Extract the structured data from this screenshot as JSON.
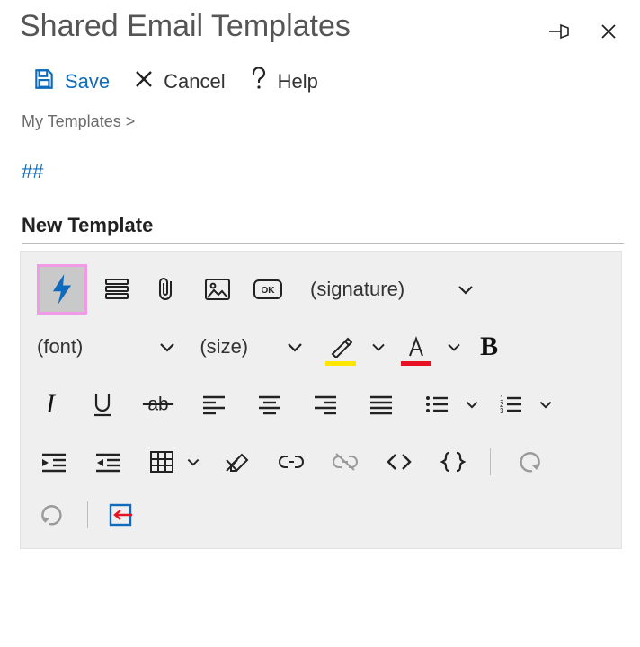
{
  "title": "Shared Email Templates",
  "actions": {
    "save": "Save",
    "cancel": "Cancel",
    "help": "Help"
  },
  "breadcrumb": "My Templates >",
  "hash_indicator": "##",
  "template_name": "New Template",
  "toolbar": {
    "signature_label": "(signature)",
    "font_label": "(font)",
    "size_label": "(size)"
  }
}
